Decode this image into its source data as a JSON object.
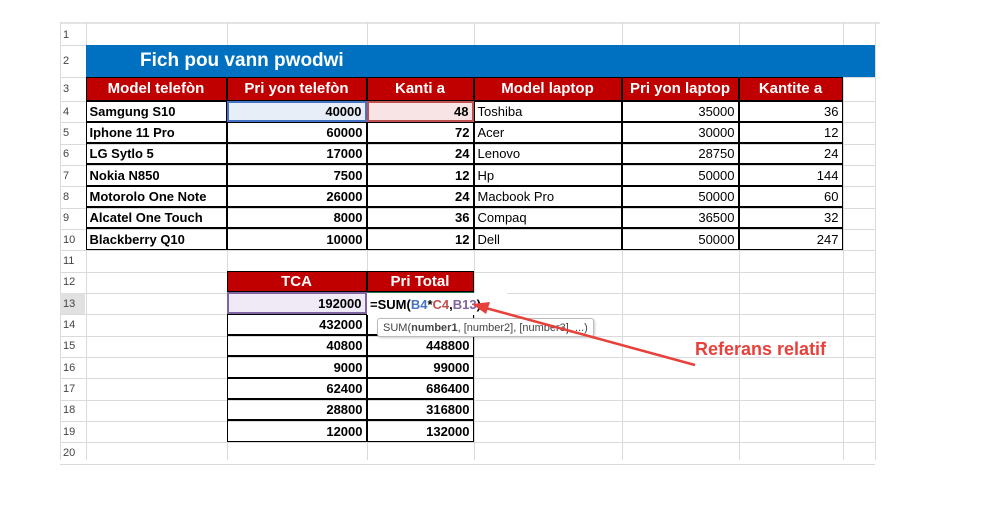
{
  "title": "Fich pou vann pwodwi",
  "row_numbers": [
    "1",
    "2",
    "3",
    "4",
    "5",
    "6",
    "7",
    "8",
    "9",
    "10",
    "11",
    "12",
    "13",
    "14",
    "15",
    "16",
    "17",
    "18",
    "19",
    "20"
  ],
  "phones": {
    "headers": [
      "Model telefòn",
      "Pri yon telefòn",
      "Kanti a"
    ],
    "rows": [
      [
        "Samgung S10",
        "40000",
        "48"
      ],
      [
        "Iphone 11 Pro",
        "60000",
        "72"
      ],
      [
        "LG Sytlo 5",
        "17000",
        "24"
      ],
      [
        "Nokia N850",
        "7500",
        "12"
      ],
      [
        "Motorolo One Note",
        "26000",
        "24"
      ],
      [
        "Alcatel One Touch",
        "8000",
        "36"
      ],
      [
        "Blackberry Q10",
        "10000",
        "12"
      ]
    ]
  },
  "laptops": {
    "headers": [
      "Model laptop",
      "Pri yon laptop",
      "Kantite a"
    ],
    "rows": [
      [
        "Toshiba",
        "35000",
        "36"
      ],
      [
        "Acer",
        "30000",
        "12"
      ],
      [
        "Lenovo",
        "28750",
        "24"
      ],
      [
        "Hp",
        "50000",
        "144"
      ],
      [
        "Macbook Pro",
        "50000",
        "60"
      ],
      [
        "Compaq",
        "36500",
        "32"
      ],
      [
        "Dell",
        "50000",
        "247"
      ]
    ]
  },
  "totals": {
    "headers": [
      "TCA",
      "Pri Total"
    ],
    "rows": [
      [
        "192000",
        ""
      ],
      [
        "432000",
        ""
      ],
      [
        "40800",
        "448800"
      ],
      [
        "9000",
        "99000"
      ],
      [
        "62400",
        "686400"
      ],
      [
        "28800",
        "316800"
      ],
      [
        "12000",
        "132000"
      ]
    ]
  },
  "formula": {
    "prefix": "=SUM(",
    "ref1": "B4",
    "op": "*",
    "ref2": "C4",
    "sep": ",",
    "ref3": "B13",
    "suffix": ")"
  },
  "tooltip": {
    "fn": "SUM(",
    "arg1": "number1",
    "rest": ", [number2], [number3], ...)"
  },
  "annotation": "Referans relatif",
  "colors": {
    "title_bg": "#0070c0",
    "header_bg": "#c00000",
    "ref_blue": "#4472c4",
    "ref_red": "#c0504d",
    "ref_purple": "#8064a2",
    "arrow": "#e8413c"
  }
}
